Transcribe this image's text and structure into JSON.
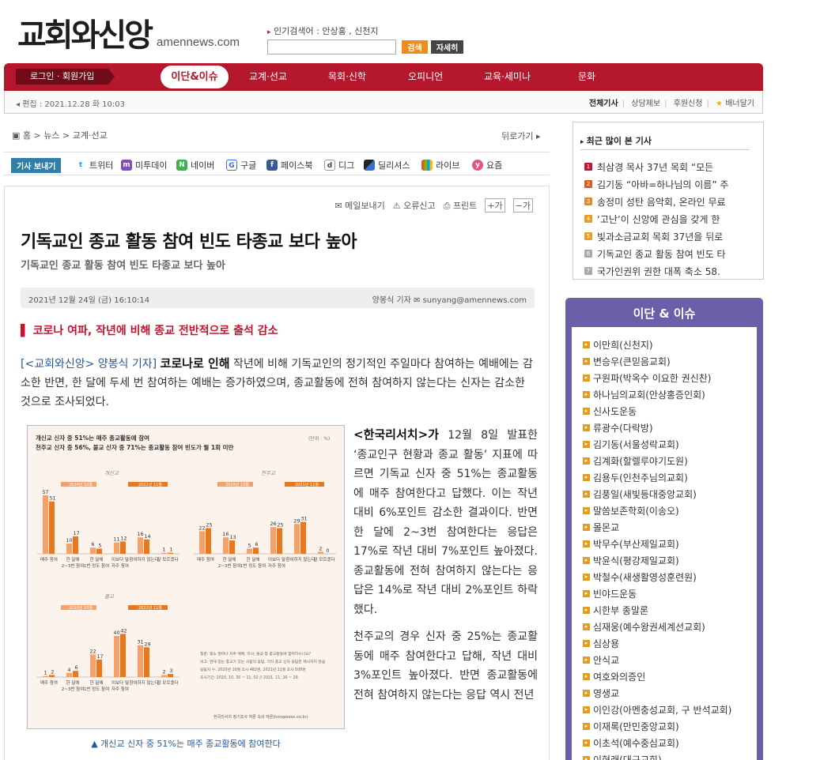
{
  "header": {
    "logo": "교회와신앙",
    "domain": "amennews.com",
    "popular_label": "인기검색어 : 안상홍 , 신천지",
    "search_button": "검색",
    "detail_button": "자세히"
  },
  "nav": {
    "login": "로그인 · 회원가입",
    "active": "이단&이슈",
    "items": [
      "교계·선교",
      "목회·신학",
      "오피니언",
      "교육·세미나",
      "문화"
    ]
  },
  "subbar": {
    "date": "편집 : 2021.12.28 화 10:03",
    "links": [
      "전체기사",
      "상담제보",
      "후원신청",
      "배너달기"
    ]
  },
  "breadcrumb": {
    "home": "홈",
    "news": "뉴스",
    "section": "교계·선교",
    "back": "뒤로가기"
  },
  "share": {
    "label": "기사 보내기",
    "items": [
      "트위터",
      "미투데이",
      "네이버",
      "구글",
      "페이스북",
      "디그",
      "딜리셔스",
      "라이브",
      "요즘"
    ]
  },
  "tools": [
    "메일보내기",
    "오류신고",
    "프린트"
  ],
  "article": {
    "title": "기독교인 종교 활동 참여 빈도 타종교 보다 높아",
    "subtitle": "기독교인 종교 활동 참여 빈도 타종교 보다 높아",
    "date": "2021년 12월 24일 (금) 16:10:14",
    "author": "양봉식 기자",
    "email": "sunyang@amennews.com",
    "lead": "코로나 여파, 작년에 비해 종교 전반적으로 출석 감소",
    "para1_source": "[<교회와신앙> 양봉식 기자]",
    "para1_strong": "코로나로 인해",
    "para1_rest": "작년에 비해 기독교인의 정기적인 주일마다 참여하는 예배에는 감소한 반면, 한 달에 두세 번 참여하는 예배는 증가하였으며, 종교활동에 전혀 참여하지 않는다는 신자는 감소한 것으로 조사되었다.",
    "body_hl": "<한국리서치>가",
    "body1": "12월 8일 발표한 ‘종교인구 현황과 종교 활동’ 지표에 따르면 기독교 신자 중 51%는 종교활동에 매주 참여한다고 답했다. 이는 작년 대비 6%포인트 감소한 결과이다. 반면 한 달에 2~3번 참여한다는 응답은 17%로 작년 대비 7%포인트 높아졌다. 종교활동에 전혀 참여하지 않는다는 응답은 14%로 작년 대비 2%포인트 하락했다.",
    "body2": "천주교의 경우 신자 중 25%는 종교활동에 매주 참여한다고 답해, 작년 대비 3%포인트 높아졌다. 반면 종교활동에 전혀 참여하지 않는다는 응답 역시 전년",
    "caption": "▲ 개신교 신자 중 51%는 매주 종교활동에 참여한다"
  },
  "chart_data": [
    {
      "type": "bar",
      "title": "개신교 신자 중 51%는 매주 종교활동에 참여",
      "subtitle": "천주교 신자 중 56%, 불교 신자 중 71%는 종교활동 참여 빈도가 월 1회 미만",
      "unit": "(단위 : %)",
      "panel": "개신교",
      "categories": [
        "매주 참여",
        "한 달에 2~3번 참여",
        "한 달에 1번 정도 참여",
        "이보다 덜 자주 참여",
        "참여하지 않는다",
        "잘 모르겠다"
      ],
      "series": [
        {
          "name": "2020년 10월",
          "values": [
            57,
            10,
            6,
            11,
            16,
            1
          ]
        },
        {
          "name": "2021년 11월",
          "values": [
            51,
            17,
            5,
            12,
            14,
            1
          ]
        }
      ]
    },
    {
      "type": "bar",
      "panel": "천주교",
      "categories": [
        "매주 참여",
        "한 달에 2~3번 참여",
        "한 달에 1번 정도 참여",
        "이보다 덜 자주 참여",
        "참여하지 않는다",
        "잘 모르겠다"
      ],
      "series": [
        {
          "name": "2020년 10월",
          "values": [
            22,
            16,
            5,
            26,
            29,
            2
          ]
        },
        {
          "name": "2021년 11월",
          "values": [
            25,
            13,
            6,
            25,
            31,
            0
          ]
        }
      ]
    },
    {
      "type": "bar",
      "panel": "불교",
      "categories": [
        "매주 참여",
        "한 달에 2~3번 참여",
        "한 달에 1번 정도 참여",
        "이보다 덜 자주 참여",
        "참여하지 않는다",
        "잘 모르겠다"
      ],
      "series": [
        {
          "name": "2020년 10월",
          "values": [
            1,
            4,
            22,
            40,
            31,
            2
          ]
        },
        {
          "name": "2021년 11월",
          "values": [
            2,
            6,
            17,
            42,
            29,
            3
          ]
        }
      ],
      "notes": [
        "질문: 평소 얼마나 자주 예배, 미사, 불공 등 종교활동에 참여하시나요?",
        "비고: 현재 믿는 종교가 있는 사람의 응답, 기타 종교 신자 응답은 제시하지 않음",
        "응답자 수: 2020년 10월 조사 482명, 2021년 11월 조사 508명",
        "조사기간: 2020. 10. 30 ~ 11. 02 // 2021. 11. 26 ~ 29"
      ],
      "source": "한국리서치 정기조사 여론 속의 여론(hrcopinion.co.kr)"
    }
  ],
  "popular": {
    "title": "최근 많이 본 기사",
    "items": [
      "최삼경 목사 37년 목회 “모든",
      "김기동 “아바=하나님의 이름” 주",
      "송정미 성탄 음악회, 온라인 무료",
      "‘고난’이 신앙에 관심을 갖게 한",
      "빛과소금교회 목회 37년을 뒤로",
      "기독교인 종교 활동 참여 빈도 타",
      "국가인권위 권한 대폭 축소 58."
    ],
    "rank_colors": [
      "#c4122f",
      "#e05a20",
      "#e88a20",
      "#e8a020",
      "#e8a020",
      "#aaaaaa",
      "#aaaaaa"
    ]
  },
  "issues": {
    "title": "이단 & 이슈",
    "items": [
      "이만희(신천지)",
      "변승우(큰믿음교회)",
      "구원파(박옥수 이요한 권신찬)",
      "하나님의교회(안상홍증인회)",
      "신사도운동",
      "류광수(다락방)",
      "김기동(서울성락교회)",
      "김계화(할렐루야기도원)",
      "김용두(인천주님의교회)",
      "김풍일(새빛등대중앙교회)",
      "말씀보존학회(이송오)",
      "몰몬교",
      "박무수(부산제일교회)",
      "박윤식(평강제일교회)",
      "박철수(새생활영성훈련원)",
      "빈야드운동",
      "시한부 종말론",
      "심재웅(예수왕권세계선교회)",
      "심상용",
      "안식교",
      "여호와의증인",
      "영생교",
      "이인강(아멘충성교회, 구 반석교회)",
      "이재록(만민중앙교회)",
      "이초석(예수중심교회)",
      "이현래(대구교회)"
    ]
  },
  "colors": {
    "brand": "#b5172d",
    "issue_purple": "#6a5fa8",
    "bar_2020": "#f5a26a",
    "bar_2021": "#e8781e"
  }
}
